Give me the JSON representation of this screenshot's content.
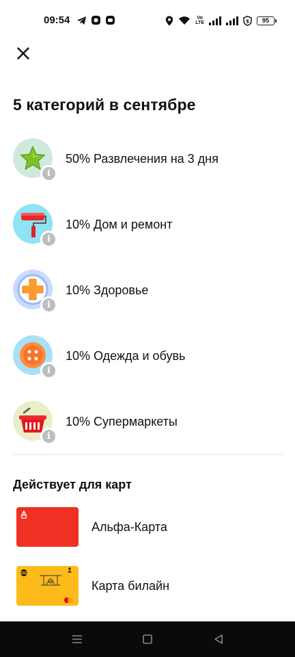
{
  "status_bar": {
    "time": "09:54",
    "battery": "95",
    "volte_top": "Vo",
    "volte_bottom": "LTE",
    "icons": [
      "telegram-icon",
      "notification-icon",
      "chat-icon",
      "location-icon",
      "wifi-icon",
      "signal-icon",
      "shield-icon",
      "battery-icon"
    ]
  },
  "header": {
    "close_icon": "close-icon",
    "title": "5 категорий в сентябре"
  },
  "categories": [
    {
      "label": "50% Развлечения на 3 дня",
      "icon": "star-icon",
      "bg": "#cfe9dc"
    },
    {
      "label": "10% Дом и ремонт",
      "icon": "paint-roller-icon",
      "bg": "#8fe3f2"
    },
    {
      "label": "10% Здоровье",
      "icon": "medical-cross-icon",
      "bg": "#c9dcff"
    },
    {
      "label": "10% Одежда и обувь",
      "icon": "button-icon",
      "bg": "#a9e0f6"
    },
    {
      "label": "10% Супермаркеты",
      "icon": "shopping-basket-icon",
      "bg": "#e8efc7"
    }
  ],
  "cards_section": {
    "title": "Действует для карт",
    "cards": [
      {
        "label": "Альфа-Карта",
        "color": "#ef3124",
        "icon": "alfa-logo-icon"
      },
      {
        "label": "Карта билайн",
        "color": "#fcbb1b",
        "icon": "beeline-logo-icon"
      }
    ]
  },
  "colors": {
    "accent_red": "#ef3124",
    "info_badge": "#bdbdbd",
    "nav_bar": "#0a0a0a"
  },
  "nav_bar": {
    "icons": [
      "menu-icon",
      "home-icon",
      "back-icon"
    ]
  }
}
